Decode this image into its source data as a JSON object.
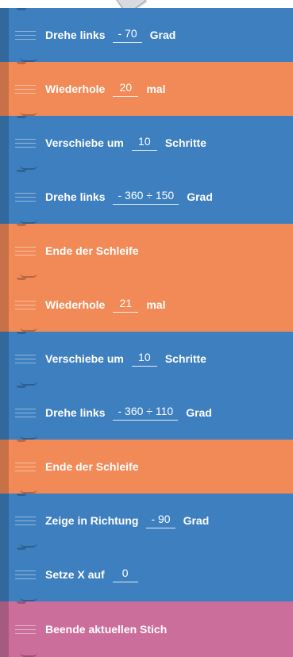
{
  "blocks": [
    {
      "id": "turn-left-1",
      "color": "#3e7fbf",
      "before": "Drehe links",
      "value": "- 70",
      "after": "Grad"
    },
    {
      "id": "repeat-1",
      "color": "#f28a57",
      "before": "Wiederhole",
      "value": "20",
      "after": "mal"
    },
    {
      "id": "move-1",
      "color": "#3e7fbf",
      "before": "Verschiebe um",
      "value": "10",
      "after": "Schritte"
    },
    {
      "id": "turn-left-2",
      "color": "#3e7fbf",
      "before": "Drehe links",
      "value": "- 360 ÷ 150",
      "after": "Grad"
    },
    {
      "id": "end-loop-1",
      "color": "#f28a57",
      "before": "Ende der Schleife",
      "value": null,
      "after": ""
    },
    {
      "id": "repeat-2",
      "color": "#f28a57",
      "before": "Wiederhole",
      "value": "21",
      "after": "mal"
    },
    {
      "id": "move-2",
      "color": "#3e7fbf",
      "before": "Verschiebe um",
      "value": "10",
      "after": "Schritte"
    },
    {
      "id": "turn-left-3",
      "color": "#3e7fbf",
      "before": "Drehe links",
      "value": "- 360 ÷ 110",
      "after": "Grad"
    },
    {
      "id": "end-loop-2",
      "color": "#f28a57",
      "before": "Ende der Schleife",
      "value": null,
      "after": ""
    },
    {
      "id": "point-direction",
      "color": "#3e7fbf",
      "before": "Zeige in Richtung",
      "value": "- 90",
      "after": "Grad"
    },
    {
      "id": "set-x",
      "color": "#3e7fbf",
      "before": "Setze X auf",
      "value": "0",
      "after": ""
    },
    {
      "id": "end-stitch",
      "color": "#cc6e9c",
      "before": "Beende aktuellen Stich",
      "value": null,
      "after": ""
    }
  ]
}
